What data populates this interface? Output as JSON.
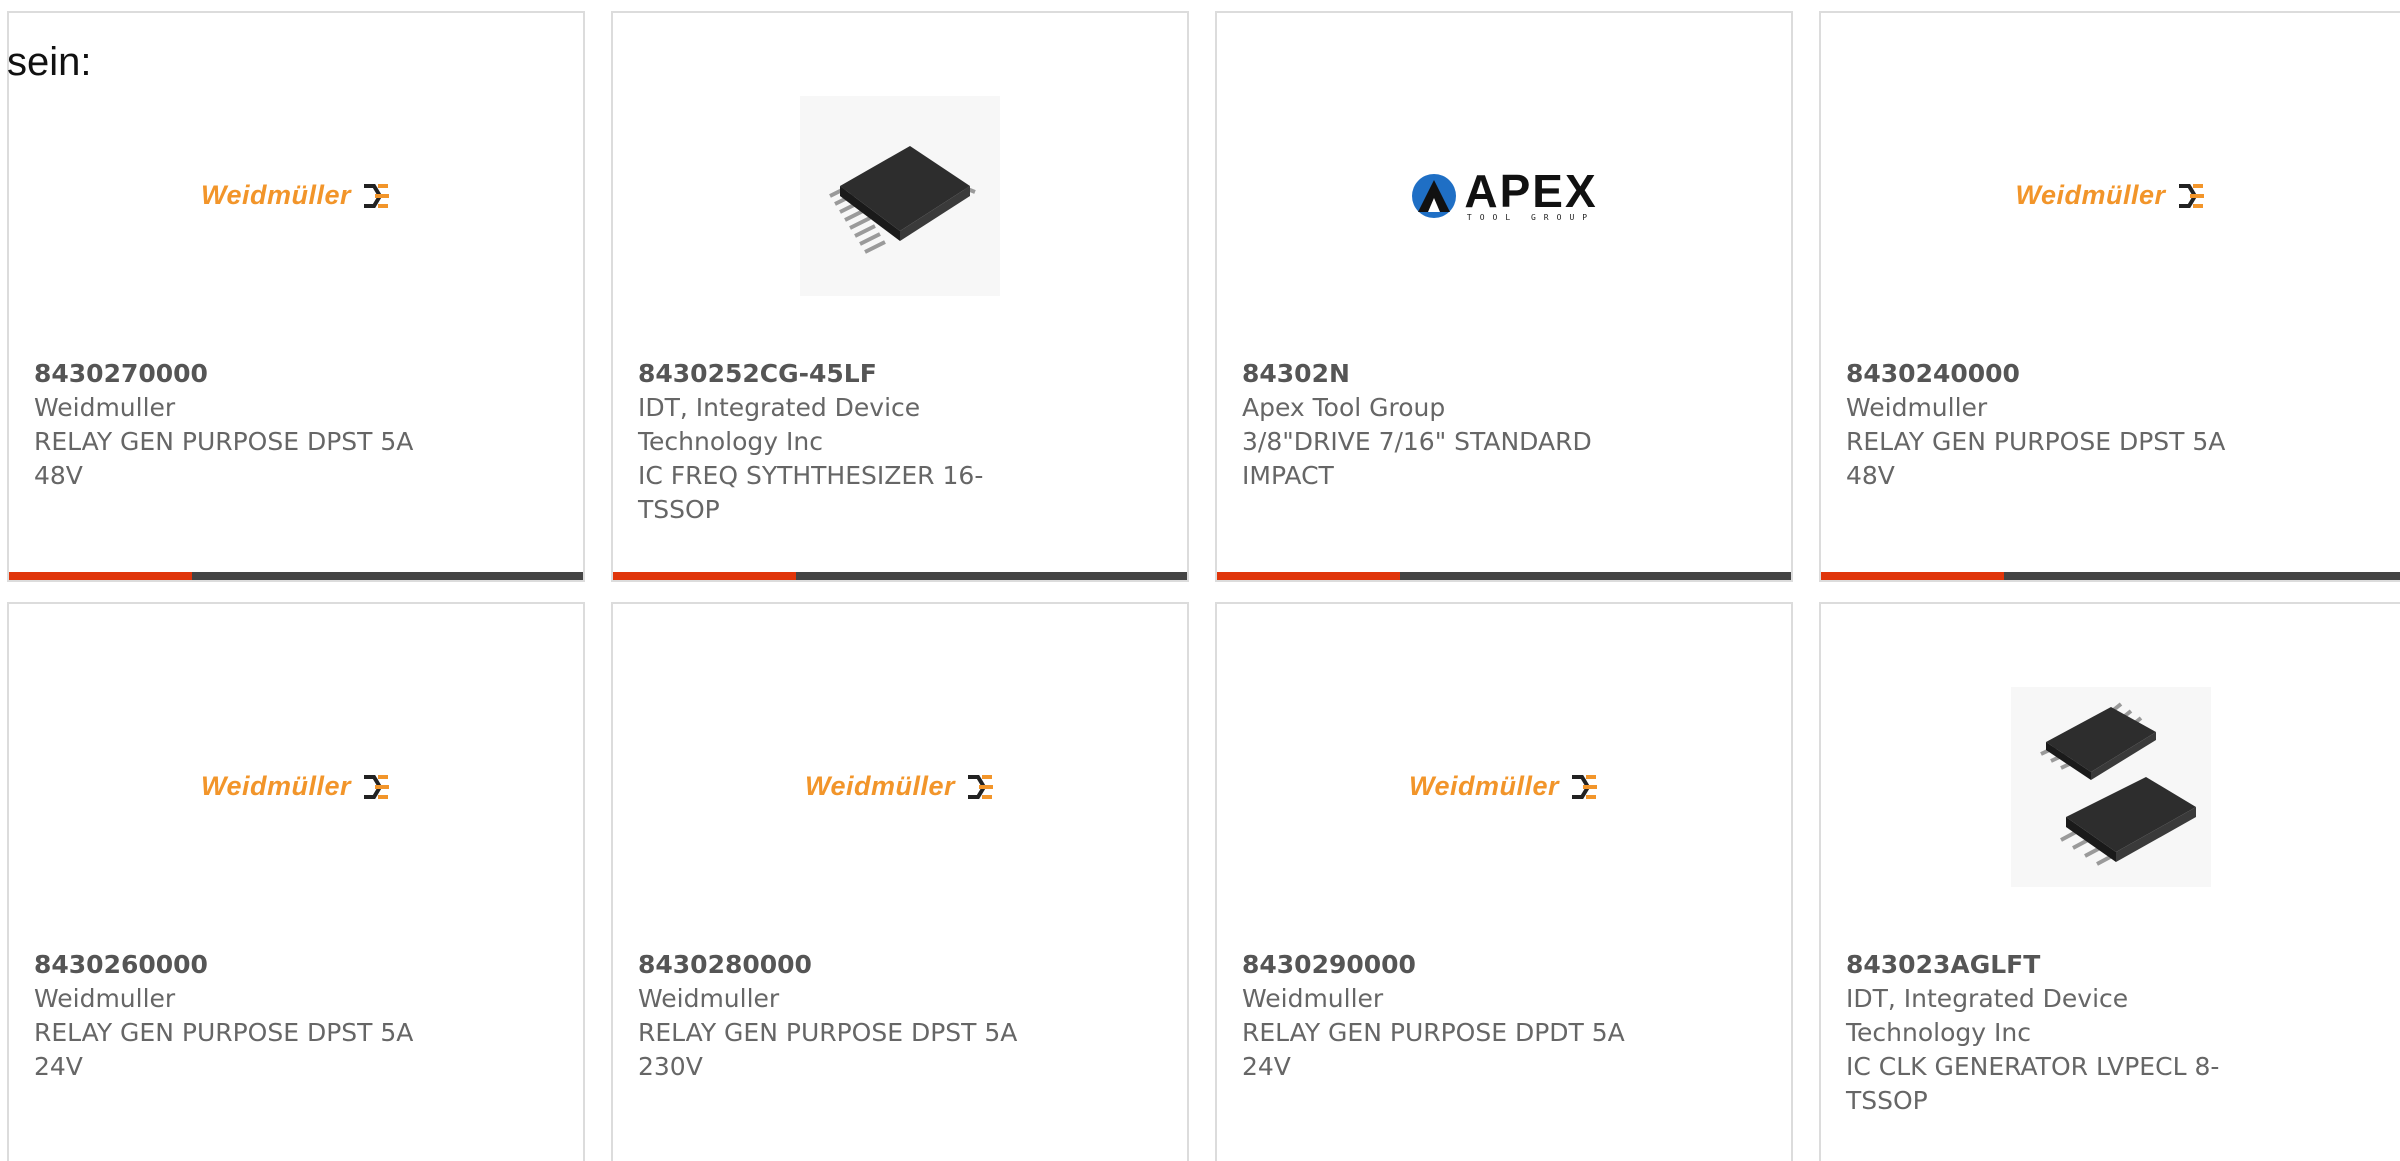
{
  "label_fragment": "sein:",
  "colors": {
    "accent": "#e0350a",
    "bar_dark": "#444444",
    "weidmuller_orange": "#f2952a"
  },
  "products": [
    {
      "part_number": "8430270000",
      "manufacturer": "Weidmuller",
      "description": "RELAY GEN PURPOSE DPST 5A 48V",
      "image": "weidmuller-logo",
      "logo_text": "Weidmüller"
    },
    {
      "part_number": "8430252CG-45LF",
      "manufacturer": "IDT, Integrated Device Technology Inc",
      "description": "IC FREQ SYTHTHESIZER 16-TSSOP",
      "image": "tssop16-chip"
    },
    {
      "part_number": "84302N",
      "manufacturer": "Apex Tool Group",
      "description": "3/8\"DRIVE 7/16\" STANDARD IMPACT",
      "image": "apex-logo",
      "logo_text": "APEX",
      "logo_subtext": "TOOL GROUP"
    },
    {
      "part_number": "8430240000",
      "manufacturer": "Weidmuller",
      "description": "RELAY GEN PURPOSE DPST 5A 48V",
      "image": "weidmuller-logo",
      "logo_text": "Weidmüller"
    },
    {
      "part_number": "8430260000",
      "manufacturer": "Weidmuller",
      "description": "RELAY GEN PURPOSE DPST 5A 24V",
      "image": "weidmuller-logo",
      "logo_text": "Weidmüller"
    },
    {
      "part_number": "8430280000",
      "manufacturer": "Weidmuller",
      "description": "RELAY GEN PURPOSE DPST 5A 230V",
      "image": "weidmuller-logo",
      "logo_text": "Weidmüller"
    },
    {
      "part_number": "8430290000",
      "manufacturer": "Weidmuller",
      "description": "RELAY GEN PURPOSE DPDT 5A 24V",
      "image": "weidmuller-logo",
      "logo_text": "Weidmüller"
    },
    {
      "part_number": "843023AGLFT",
      "manufacturer": "IDT, Integrated Device Technology Inc",
      "description": "IC CLK GENERATOR LVPECL 8-TSSOP",
      "image": "tssop8-chips"
    }
  ]
}
